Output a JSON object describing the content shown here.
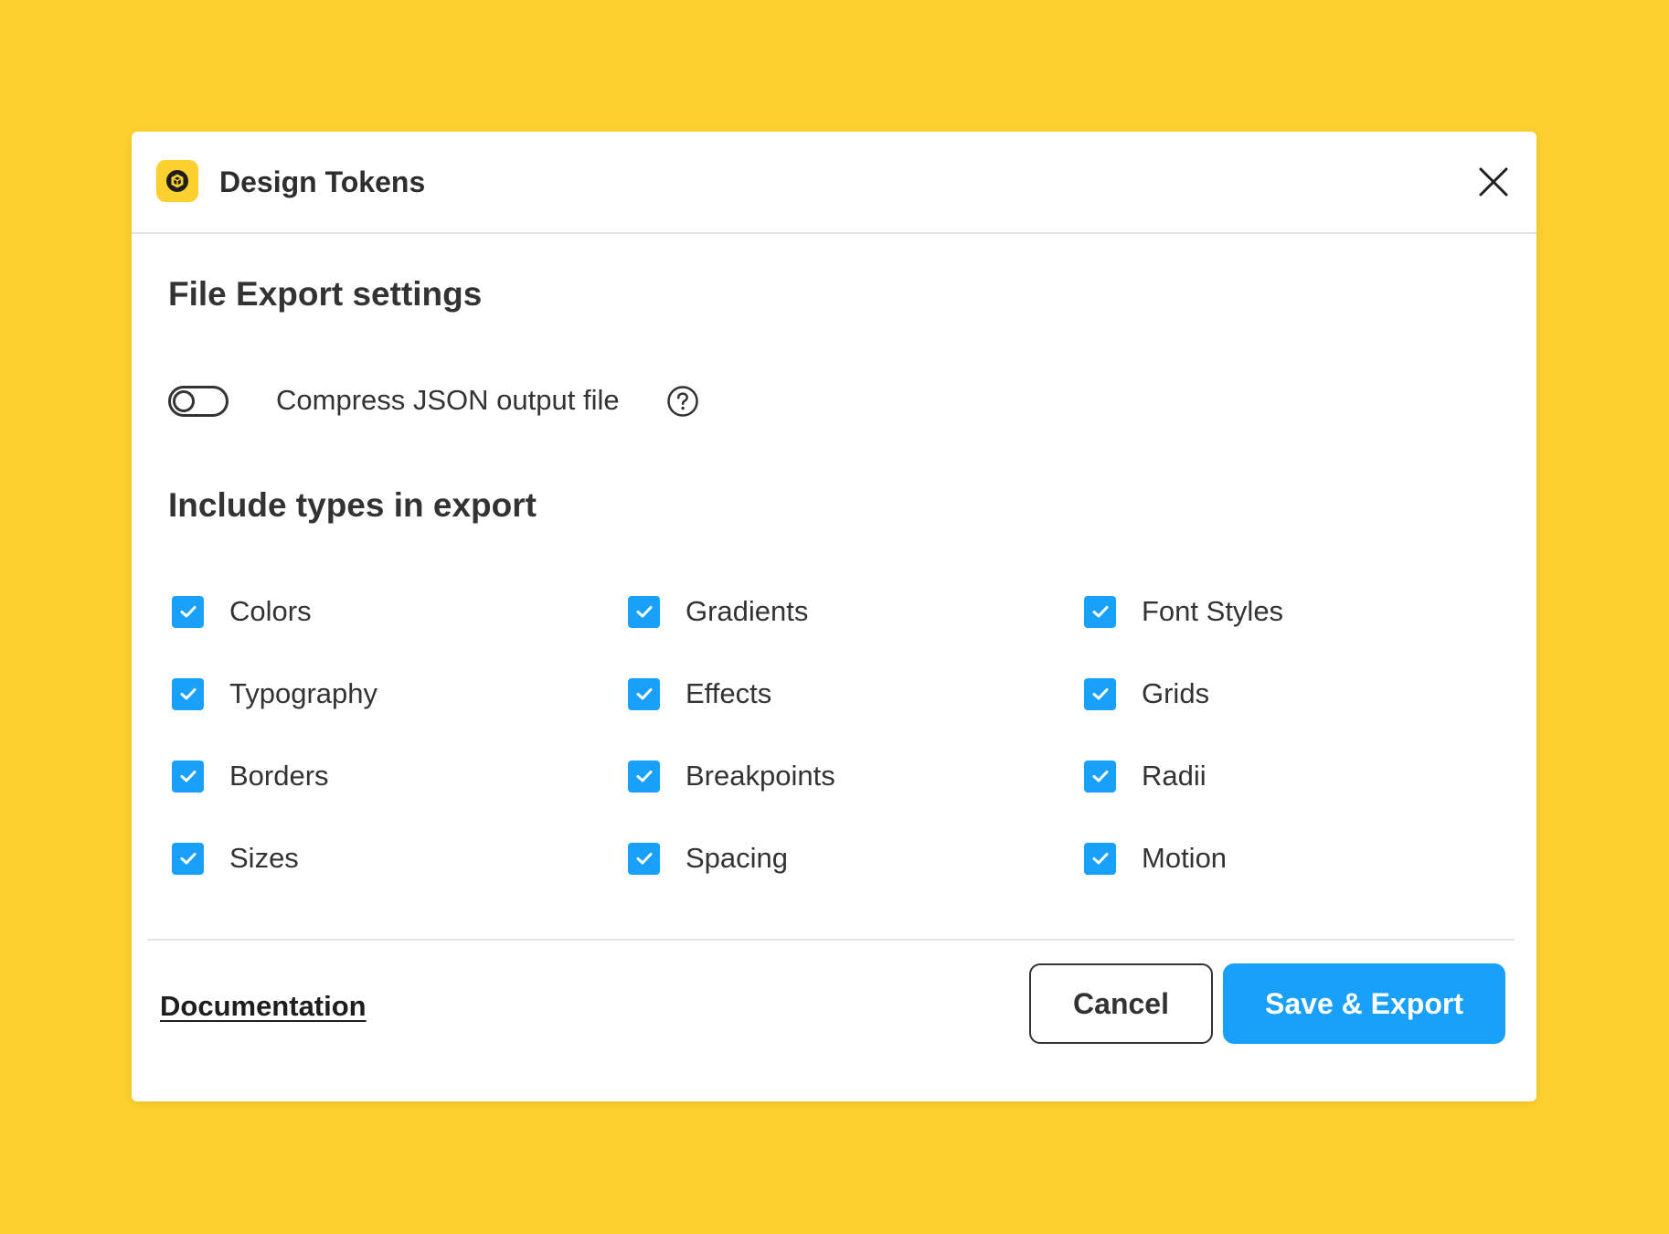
{
  "window": {
    "title": "Design Tokens",
    "app_icon": "design-tokens-logo-icon",
    "close_icon": "close-icon"
  },
  "settings": {
    "section_title": "File Export settings",
    "compress_toggle": {
      "label": "Compress JSON output file",
      "enabled": false,
      "help_icon": "help-icon"
    }
  },
  "types": {
    "section_title": "Include types in export",
    "items": [
      {
        "label": "Colors",
        "checked": true
      },
      {
        "label": "Gradients",
        "checked": true
      },
      {
        "label": "Font Styles",
        "checked": true
      },
      {
        "label": "Typography",
        "checked": true
      },
      {
        "label": "Effects",
        "checked": true
      },
      {
        "label": "Grids",
        "checked": true
      },
      {
        "label": "Borders",
        "checked": true
      },
      {
        "label": "Breakpoints",
        "checked": true
      },
      {
        "label": "Radii",
        "checked": true
      },
      {
        "label": "Sizes",
        "checked": true
      },
      {
        "label": "Spacing",
        "checked": true
      },
      {
        "label": "Motion",
        "checked": true
      }
    ]
  },
  "footer": {
    "documentation_link": "Documentation",
    "cancel_label": "Cancel",
    "save_label": "Save & Export"
  },
  "colors": {
    "background": "#FCD02E",
    "accent": "#18A0FB",
    "text": "#333333"
  }
}
